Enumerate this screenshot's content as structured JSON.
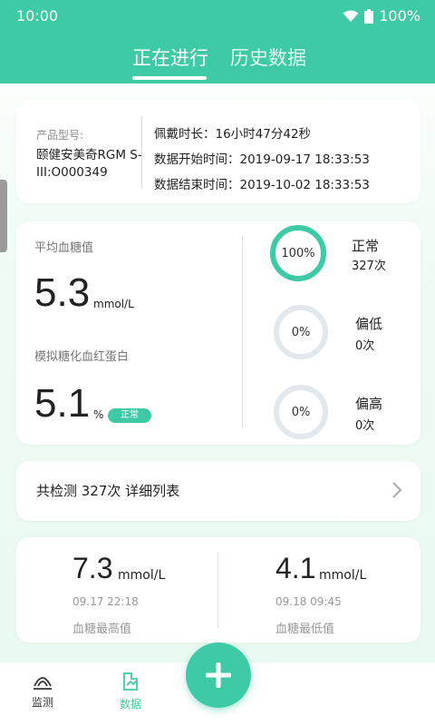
{
  "status_bar": {
    "time": "10:00",
    "battery": "100%"
  },
  "tabs": [
    {
      "label": "正在进行",
      "active": true
    },
    {
      "label": "历史数据",
      "active": false
    }
  ],
  "device": {
    "product_label": "产品型号:",
    "product_value": "颐健安美奇RGM S-III:O000349",
    "wear_duration": "佩戴时长：16小时47分42秒",
    "start_time": "数据开始时间：2019-09-17 18:33:53",
    "end_time": "数据结束时间：2019-10-02 18:33:53"
  },
  "summary": {
    "avg_label": "平均血糖值",
    "avg_value": "5.3",
    "avg_unit": "mmol/L",
    "hba1c_label": "模拟糖化血红蛋白",
    "hba1c_value": "5.1",
    "hba1c_unit": "%",
    "hba1c_badge": "正常",
    "rings": [
      {
        "percent": "100%",
        "title": "正常",
        "count": "327次",
        "fill": 1.0
      },
      {
        "percent": "0%",
        "title": "偏低",
        "count": "0次",
        "fill": 0.0
      },
      {
        "percent": "0%",
        "title": "偏高",
        "count": "0次",
        "fill": 0.0
      }
    ]
  },
  "total": {
    "text": "共检测 327次 详细列表"
  },
  "extremes": {
    "max": {
      "value": "7.3",
      "unit": "mmol/L",
      "time": "09.17 22:18",
      "label": "血糖最高值"
    },
    "min": {
      "value": "4.1",
      "unit": "mmol/L",
      "time": "09.18 09:45",
      "label": "血糖最低值"
    }
  },
  "bottom_nav": [
    {
      "label": "监测",
      "icon": "monitor-icon",
      "active": false
    },
    {
      "label": "数据",
      "icon": "data-icon",
      "active": true
    }
  ],
  "fab": {
    "icon": "plus-icon"
  },
  "colors": {
    "accent": "#3ecaa5",
    "ring_empty": "#e3e8ec"
  }
}
